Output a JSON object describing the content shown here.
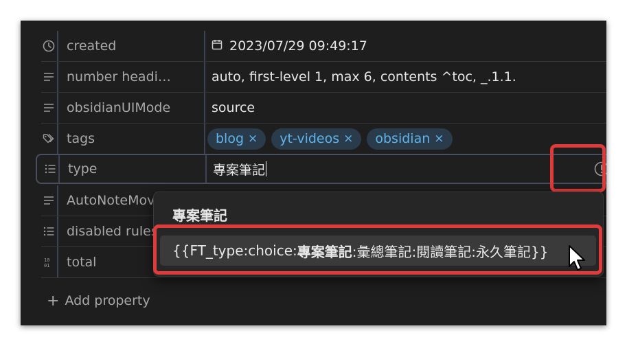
{
  "properties": [
    {
      "key": "created",
      "icon": "clock-icon",
      "value": "2023/07/29 09:49:17",
      "value_icon": "calendar-icon"
    },
    {
      "key": "number headi…",
      "icon": "text-lines-icon",
      "value": "auto, first-level 1, max 6, contents ^toc, _.1.1."
    },
    {
      "key": "obsidianUIMode",
      "icon": "text-lines-icon",
      "value": "source"
    },
    {
      "key": "tags",
      "icon": "tags-icon",
      "tags": [
        "blog",
        "yt-videos",
        "obsidian"
      ],
      "tag_remove": "×"
    },
    {
      "key": "type",
      "icon": "list-icon",
      "value": "專案筆記"
    },
    {
      "key": "AutoNoteMov",
      "icon": "text-lines-icon"
    },
    {
      "key": "disabled rules",
      "icon": "list-icon"
    },
    {
      "key": "total",
      "icon": "number-icon"
    }
  ],
  "type_row_warning_icon": "alert-circle-icon",
  "dropdown": {
    "title": "專案筆記",
    "suggestion_prefix": "{{FT_type:choice:",
    "suggestion_match": "專案筆記",
    "suggestion_suffix": ":彙總筆記:閱讀筆記:永久筆記}}"
  },
  "add_property": {
    "icon": "plus-icon",
    "label": "Add property"
  },
  "colors": {
    "background": "#1e1e1e",
    "tag_bg": "#2a3b4c",
    "tag_text": "#5fb4ea",
    "highlight": "#e03a3a"
  }
}
